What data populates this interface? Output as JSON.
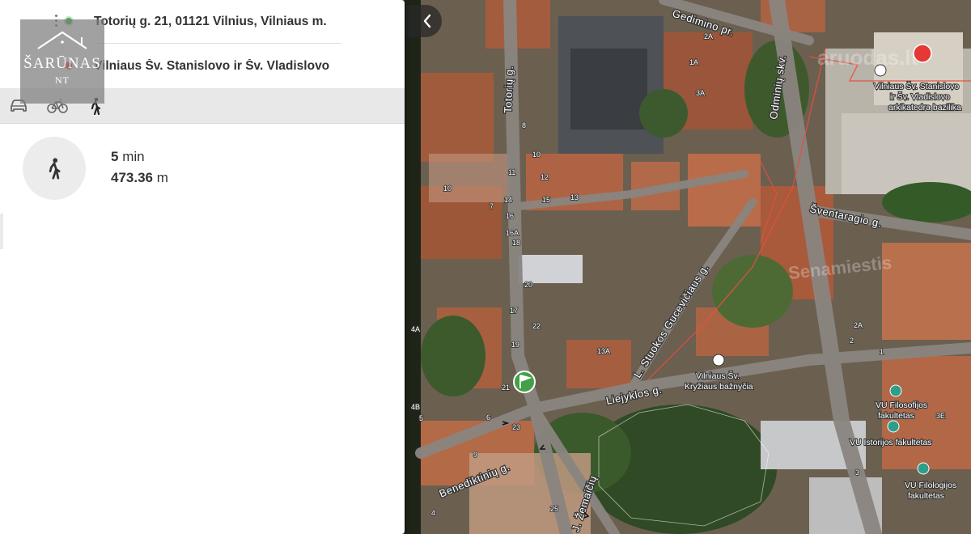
{
  "route": {
    "from": "Totorių g. 21, 01121 Vilnius, Vilniaus m.",
    "to": "Vilniaus Šv. Stanislovo ir Šv. Vladislovo"
  },
  "modes": [
    {
      "name": "car",
      "icon": "car-icon",
      "active": false
    },
    {
      "name": "bike",
      "icon": "bicycle-icon",
      "active": false
    },
    {
      "name": "walk",
      "icon": "walking-icon",
      "active": true
    }
  ],
  "summary": {
    "time_value": "5",
    "time_unit": "min",
    "distance_value": "473.36",
    "distance_unit": "m"
  },
  "logo": {
    "name": "ŠARŪNAS",
    "sub": "NT"
  },
  "map": {
    "watermarks": [
      "aruodas.lt",
      "Senamiestis"
    ],
    "streets": [
      "Totorių g.",
      "Odminių skv.",
      "Šventaragio g.",
      "L. Stuokos Gucevičiaus g.",
      "Liejyklos g.",
      "Benediktinių g.",
      "J. Žemaičių",
      "Gedimino pr."
    ],
    "pois": [
      "Vilniaus Šv. Stanislovo",
      "ir Šv. Vladislovo",
      "arkikatedra bazilika",
      "Vilniaus Šv.",
      "Kryžiaus bažnyčia",
      "VU Filosofijos",
      "fakultetas",
      "VU Istorijos fakultetas",
      "VU Filologijos",
      "fakultetas"
    ],
    "house_numbers": [
      "2A",
      "1A",
      "3A",
      "8",
      "10",
      "12",
      "14",
      "16",
      "16A",
      "18",
      "20",
      "22",
      "13",
      "15",
      "11",
      "17",
      "19",
      "21",
      "23",
      "25",
      "9",
      "7",
      "5",
      "4",
      "3",
      "2",
      "1",
      "4A",
      "4B",
      "6",
      "10",
      "13A",
      "2A",
      "3E"
    ]
  },
  "colors": {
    "accent_green": "#4caf50",
    "accent_red": "#e53935",
    "panel_bg": "#ffffff",
    "mode_bar_bg": "#e8e8e8"
  }
}
